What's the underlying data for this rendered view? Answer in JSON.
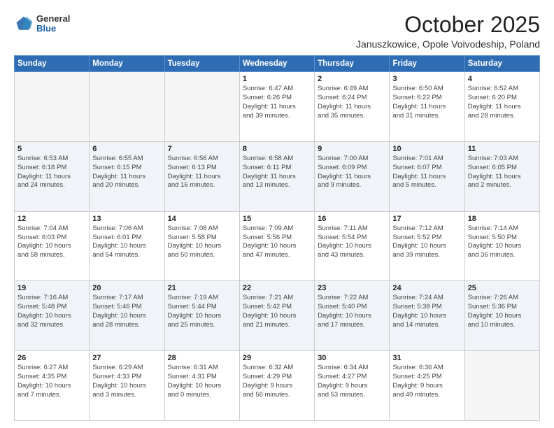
{
  "header": {
    "logo_general": "General",
    "logo_blue": "Blue",
    "month_title": "October 2025",
    "location": "Januszkowice, Opole Voivodeship, Poland"
  },
  "weekdays": [
    "Sunday",
    "Monday",
    "Tuesday",
    "Wednesday",
    "Thursday",
    "Friday",
    "Saturday"
  ],
  "weeks": [
    [
      {
        "day": "",
        "info": ""
      },
      {
        "day": "",
        "info": ""
      },
      {
        "day": "",
        "info": ""
      },
      {
        "day": "1",
        "info": "Sunrise: 6:47 AM\nSunset: 6:26 PM\nDaylight: 11 hours\nand 39 minutes."
      },
      {
        "day": "2",
        "info": "Sunrise: 6:49 AM\nSunset: 6:24 PM\nDaylight: 11 hours\nand 35 minutes."
      },
      {
        "day": "3",
        "info": "Sunrise: 6:50 AM\nSunset: 6:22 PM\nDaylight: 11 hours\nand 31 minutes."
      },
      {
        "day": "4",
        "info": "Sunrise: 6:52 AM\nSunset: 6:20 PM\nDaylight: 11 hours\nand 28 minutes."
      }
    ],
    [
      {
        "day": "5",
        "info": "Sunrise: 6:53 AM\nSunset: 6:18 PM\nDaylight: 11 hours\nand 24 minutes."
      },
      {
        "day": "6",
        "info": "Sunrise: 6:55 AM\nSunset: 6:15 PM\nDaylight: 11 hours\nand 20 minutes."
      },
      {
        "day": "7",
        "info": "Sunrise: 6:56 AM\nSunset: 6:13 PM\nDaylight: 11 hours\nand 16 minutes."
      },
      {
        "day": "8",
        "info": "Sunrise: 6:58 AM\nSunset: 6:11 PM\nDaylight: 11 hours\nand 13 minutes."
      },
      {
        "day": "9",
        "info": "Sunrise: 7:00 AM\nSunset: 6:09 PM\nDaylight: 11 hours\nand 9 minutes."
      },
      {
        "day": "10",
        "info": "Sunrise: 7:01 AM\nSunset: 6:07 PM\nDaylight: 11 hours\nand 5 minutes."
      },
      {
        "day": "11",
        "info": "Sunrise: 7:03 AM\nSunset: 6:05 PM\nDaylight: 11 hours\nand 2 minutes."
      }
    ],
    [
      {
        "day": "12",
        "info": "Sunrise: 7:04 AM\nSunset: 6:03 PM\nDaylight: 10 hours\nand 58 minutes."
      },
      {
        "day": "13",
        "info": "Sunrise: 7:06 AM\nSunset: 6:01 PM\nDaylight: 10 hours\nand 54 minutes."
      },
      {
        "day": "14",
        "info": "Sunrise: 7:08 AM\nSunset: 5:58 PM\nDaylight: 10 hours\nand 50 minutes."
      },
      {
        "day": "15",
        "info": "Sunrise: 7:09 AM\nSunset: 5:56 PM\nDaylight: 10 hours\nand 47 minutes."
      },
      {
        "day": "16",
        "info": "Sunrise: 7:11 AM\nSunset: 5:54 PM\nDaylight: 10 hours\nand 43 minutes."
      },
      {
        "day": "17",
        "info": "Sunrise: 7:12 AM\nSunset: 5:52 PM\nDaylight: 10 hours\nand 39 minutes."
      },
      {
        "day": "18",
        "info": "Sunrise: 7:14 AM\nSunset: 5:50 PM\nDaylight: 10 hours\nand 36 minutes."
      }
    ],
    [
      {
        "day": "19",
        "info": "Sunrise: 7:16 AM\nSunset: 5:48 PM\nDaylight: 10 hours\nand 32 minutes."
      },
      {
        "day": "20",
        "info": "Sunrise: 7:17 AM\nSunset: 5:46 PM\nDaylight: 10 hours\nand 28 minutes."
      },
      {
        "day": "21",
        "info": "Sunrise: 7:19 AM\nSunset: 5:44 PM\nDaylight: 10 hours\nand 25 minutes."
      },
      {
        "day": "22",
        "info": "Sunrise: 7:21 AM\nSunset: 5:42 PM\nDaylight: 10 hours\nand 21 minutes."
      },
      {
        "day": "23",
        "info": "Sunrise: 7:22 AM\nSunset: 5:40 PM\nDaylight: 10 hours\nand 17 minutes."
      },
      {
        "day": "24",
        "info": "Sunrise: 7:24 AM\nSunset: 5:38 PM\nDaylight: 10 hours\nand 14 minutes."
      },
      {
        "day": "25",
        "info": "Sunrise: 7:26 AM\nSunset: 5:36 PM\nDaylight: 10 hours\nand 10 minutes."
      }
    ],
    [
      {
        "day": "26",
        "info": "Sunrise: 6:27 AM\nSunset: 4:35 PM\nDaylight: 10 hours\nand 7 minutes."
      },
      {
        "day": "27",
        "info": "Sunrise: 6:29 AM\nSunset: 4:33 PM\nDaylight: 10 hours\nand 3 minutes."
      },
      {
        "day": "28",
        "info": "Sunrise: 6:31 AM\nSunset: 4:31 PM\nDaylight: 10 hours\nand 0 minutes."
      },
      {
        "day": "29",
        "info": "Sunrise: 6:32 AM\nSunset: 4:29 PM\nDaylight: 9 hours\nand 56 minutes."
      },
      {
        "day": "30",
        "info": "Sunrise: 6:34 AM\nSunset: 4:27 PM\nDaylight: 9 hours\nand 53 minutes."
      },
      {
        "day": "31",
        "info": "Sunrise: 6:36 AM\nSunset: 4:25 PM\nDaylight: 9 hours\nand 49 minutes."
      },
      {
        "day": "",
        "info": ""
      }
    ]
  ]
}
